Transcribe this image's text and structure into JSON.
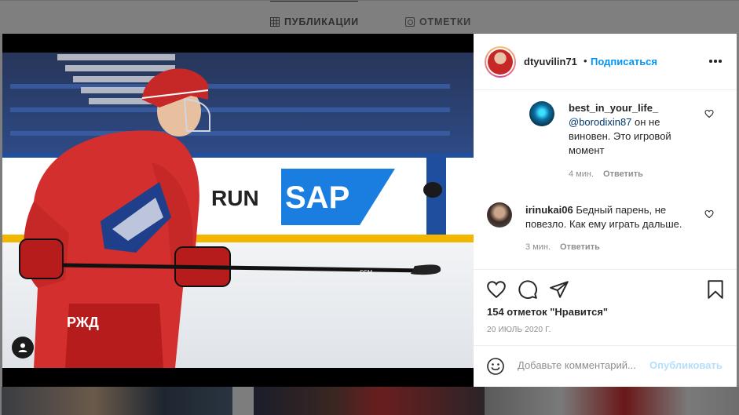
{
  "profile_tabs": {
    "posts_label": "ПУБЛИКАЦИИ",
    "tagged_label": "ОТМЕТКИ"
  },
  "post": {
    "author": "dtyuvilin71",
    "dot": "•",
    "follow_label": "Подписаться",
    "photo_text": {
      "ad_board_left": "RUN",
      "ad_board_sap": "SAP",
      "jersey_logo": "РЖД",
      "stick_brand": "CCM"
    },
    "comments": [
      {
        "user": "best_in_your_life_",
        "mention": "@borodixin87",
        "text": " он не виновен. Это игровой момент",
        "time": "4 мин.",
        "reply_label": "Ответить"
      },
      {
        "user": "irinukai06",
        "text": "Бедный парень, не повезло. Как ему играть дальше.",
        "time": "3 мин.",
        "reply_label": "Ответить"
      }
    ],
    "likes": "154 отметок \"Нравится\"",
    "date": "20 ИЮЛЬ 2020 Г.",
    "comment_placeholder": "Добавьте комментарий...",
    "publish_label": "Опубликовать"
  },
  "colors": {
    "link_blue": "#0095f6",
    "publish_disabled": "#b2dffc",
    "jersey_red": "#d32f2f",
    "backdrop": "#7d7d7d"
  },
  "icons": [
    "heart-icon",
    "comment-icon",
    "share-icon",
    "bookmark-icon",
    "more-icon",
    "emoji-icon",
    "user-tag-icon",
    "grid-icon",
    "tag-icon"
  ]
}
